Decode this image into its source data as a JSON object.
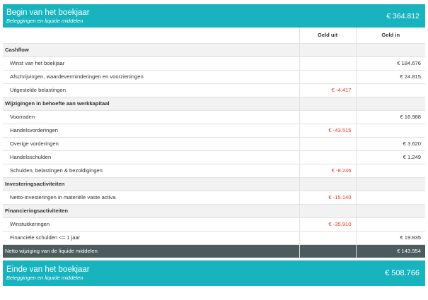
{
  "begin": {
    "title": "Begin van het boekjaar",
    "subtitle": "Beleggingen en liquide middelen",
    "amount": "€ 364.812"
  },
  "columns": {
    "out": "Geld uit",
    "in": "Geld in"
  },
  "rows": [
    {
      "label": "Cashflow",
      "type": "section",
      "out": "",
      "in": ""
    },
    {
      "label": "Winst van het boekjaar",
      "type": "item",
      "out": "",
      "in": "€ 184.676"
    },
    {
      "label": "Afschrijvingen, waardeverminderingen en voorzieningen",
      "type": "item",
      "out": "",
      "in": "€ 24.815"
    },
    {
      "label": "Uitgestelde belastingen",
      "type": "item",
      "out": "€ -4.417",
      "in": ""
    },
    {
      "label": "Wijzigingen in behoefte aan werkkapitaal",
      "type": "section",
      "out": "",
      "in": ""
    },
    {
      "label": "Voorraden",
      "type": "item",
      "out": "",
      "in": "€ 16.988"
    },
    {
      "label": "Handelsvorderingen",
      "type": "item",
      "out": "€ -43.515",
      "in": ""
    },
    {
      "label": "Overige vorderingen",
      "type": "item",
      "out": "",
      "in": "€ 3.620"
    },
    {
      "label": "Handelsschulden",
      "type": "item",
      "out": "",
      "in": "€ 1.249"
    },
    {
      "label": "Schulden, belastingen & bezoldigingen",
      "type": "item",
      "out": "€ -8.246",
      "in": ""
    },
    {
      "label": "Investeringsactiviteiten",
      "type": "section",
      "out": "",
      "in": ""
    },
    {
      "label": "Netto-investeringen in materiële vaste activa",
      "type": "item",
      "out": "€ -15.140",
      "in": ""
    },
    {
      "label": "Financieringsactiviteiten",
      "type": "section",
      "out": "",
      "in": ""
    },
    {
      "label": "Winstuitkeringen",
      "type": "item",
      "out": "€ -35.910",
      "in": ""
    },
    {
      "label": "Financiële schulden <= 1 jaar",
      "type": "item",
      "out": "",
      "in": "€ 19.835"
    }
  ],
  "net": {
    "label": "Netto wijziging van de liquide middelen",
    "amount": "€ 143.954"
  },
  "end": {
    "title": "Einde van het boekjaar",
    "subtitle": "Beleggingen en liquide middelen",
    "amount": "€ 508.766"
  },
  "colors": {
    "banner": "#17b4bf",
    "net_row": "#4c5b5d",
    "negative": "#e03a2e",
    "section_bg": "#f2f2f2"
  }
}
